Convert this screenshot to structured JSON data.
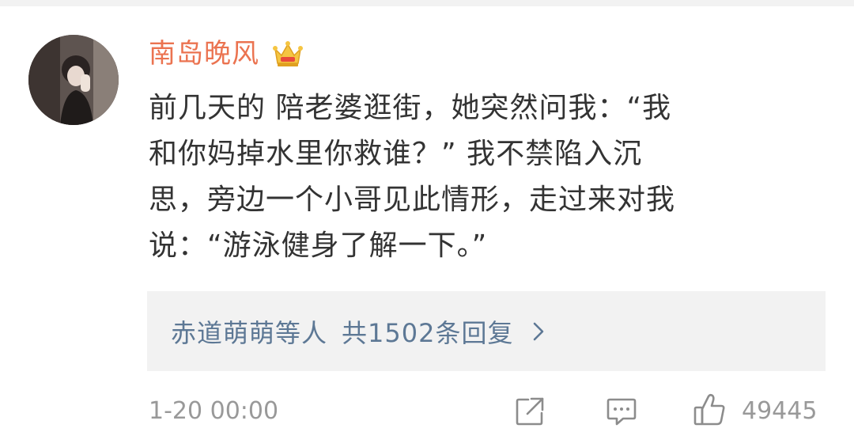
{
  "comment": {
    "username": "南岛晚风",
    "badge_icon": "crown-icon",
    "text_lines": [
      "前几天的  陪老婆逛街，她突然问我：“我",
      "和你妈掉水里你救谁？” 我不禁陷入沉",
      "思，旁边一个小哥见此情形，走过来对我",
      "说：“游泳健身了解一下。”"
    ],
    "timestamp": "1-20 00:00",
    "like_count": "49445"
  },
  "replies": {
    "preview": "赤道萌萌等人",
    "count_label": "共1502条回复"
  },
  "icons": {
    "share": "share-icon",
    "comment": "comment-icon",
    "like": "thumbs-up-icon",
    "chevron": "chevron-right-icon"
  },
  "colors": {
    "username": "#eb7350",
    "body_text": "#333333",
    "link": "#5d7895",
    "meta": "#999999",
    "reply_bg": "#f2f2f2"
  }
}
